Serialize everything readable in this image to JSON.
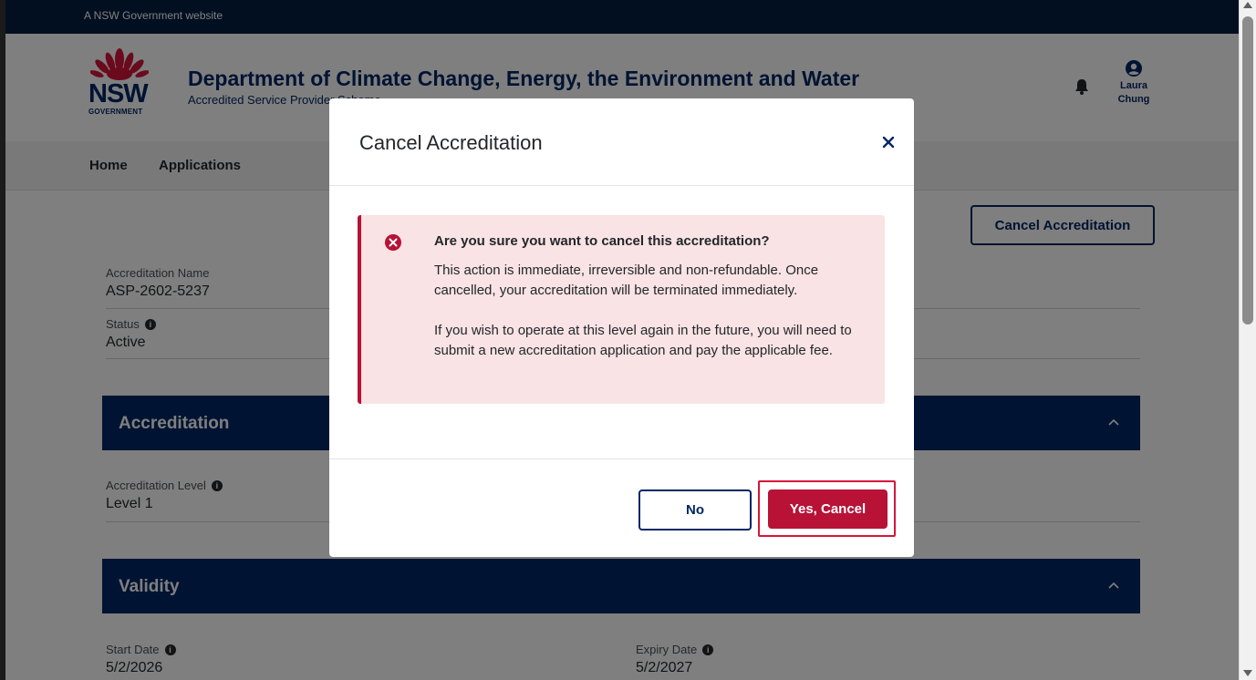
{
  "gov_strip": "A NSW Government website",
  "logo": {
    "nsw": "NSW",
    "government": "GOVERNMENT"
  },
  "header": {
    "title": "Department of Climate Change, Energy, the Environment and Water",
    "subtitle": "Accredited Service Provider Scheme",
    "user_first": "Laura",
    "user_last": "Chung"
  },
  "nav": {
    "home": "Home",
    "applications": "Applications"
  },
  "page": {
    "cancel_button": "Cancel Accreditation",
    "accreditation_name_label": "Accreditation Name",
    "accreditation_name_value": "ASP-2602-5237",
    "status_label": "Status",
    "status_value": "Active",
    "section_accreditation": "Accreditation",
    "accreditation_level_label": "Accreditation Level",
    "accreditation_level_value": "Level 1",
    "section_validity": "Validity",
    "start_date_label": "Start Date",
    "start_date_value": "5/2/2026",
    "expiry_date_label": "Expiry Date",
    "expiry_date_value": "5/2/2027"
  },
  "modal": {
    "title": "Cancel Accreditation",
    "alert_title": "Are you sure you want to cancel this accreditation?",
    "alert_para1": "This action is immediate, irreversible and non-refundable. Once cancelled, your accreditation will be terminated immediately.",
    "alert_para2": "If you wish to operate at this level again in the future, you will need to submit a new accreditation application and pay the applicable fee.",
    "no_button": "No",
    "yes_button": "Yes, Cancel"
  },
  "colors": {
    "navy": "#002664",
    "red": "#b81237",
    "alert_bg": "#f9e3e4",
    "highlight": "#d7153a"
  }
}
